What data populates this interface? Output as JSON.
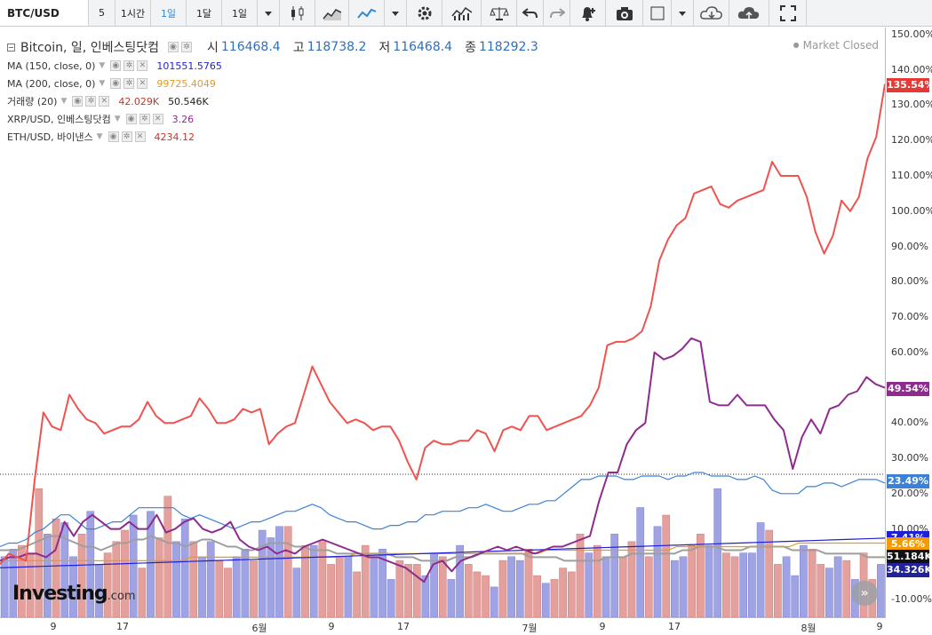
{
  "toolbar": {
    "symbol": "BTC/USD",
    "buttons": [
      {
        "label": "5",
        "icon": ""
      },
      {
        "label": "1시간",
        "icon": ""
      },
      {
        "label": "1일",
        "icon": "",
        "active": true
      },
      {
        "label": "1달",
        "icon": ""
      },
      {
        "label": "1일",
        "icon": ""
      },
      {
        "label": "",
        "icon": "dropdown-caret-icon"
      },
      {
        "label": "",
        "icon": "candlestick-icon"
      },
      {
        "label": "",
        "icon": "area-chart-icon"
      },
      {
        "label": "",
        "icon": "line-chart-icon",
        "active": true
      },
      {
        "label": "",
        "icon": "dropdown-caret-icon"
      },
      {
        "label": "",
        "icon": "gear-icon"
      },
      {
        "label": "",
        "icon": "indicators-icon"
      },
      {
        "label": "",
        "icon": "scales-icon"
      },
      {
        "label": "",
        "icon": "undo-icon"
      },
      {
        "label": "",
        "icon": "redo-icon"
      },
      {
        "label": "",
        "icon": "alert-bell-icon"
      },
      {
        "label": "",
        "icon": "camera-icon"
      },
      {
        "label": "",
        "icon": "color-square-icon"
      },
      {
        "label": "",
        "icon": "dropdown-caret-icon"
      },
      {
        "label": "",
        "icon": "cloud-download-icon"
      },
      {
        "label": "",
        "icon": "cloud-upload-icon"
      },
      {
        "label": "",
        "icon": "fullscreen-icon"
      }
    ]
  },
  "legend": {
    "main": {
      "name": "Bitcoin, 일, 인베스팅닷컴",
      "o_label": "시",
      "o": "116468.4",
      "h_label": "고",
      "h": "118738.2",
      "l_label": "저",
      "l": "116468.4",
      "c_label": "종",
      "c": "118292.3"
    },
    "studies": [
      {
        "name": "MA (150, close, 0)",
        "values": [
          "101551.5765"
        ],
        "colors": [
          "#1f1fd6"
        ]
      },
      {
        "name": "MA (200, close, 0)",
        "values": [
          "99725.4049"
        ],
        "colors": [
          "#e89a1a"
        ]
      },
      {
        "name": "거래량 (20)",
        "values": [
          "42.029K",
          "50.546K"
        ],
        "colors": [
          "#c0392b",
          "#222222"
        ]
      },
      {
        "name": "XRP/USD, 인베스팅닷컴",
        "values": [
          "3.26"
        ],
        "colors": [
          "#8e2b8e"
        ]
      },
      {
        "name": "ETH/USD, 바이낸스",
        "values": [
          "4234.12"
        ],
        "colors": [
          "#c0392b"
        ]
      }
    ]
  },
  "status": "Market Closed",
  "logo": {
    "main": "Investing",
    "suffix": ".com"
  },
  "scroll_button": "»",
  "price_axis": {
    "labels": [
      "150.00%",
      "140.00%",
      "130.00%",
      "120.00%",
      "110.00%",
      "100.00%",
      "90.00%",
      "80.00%",
      "70.00%",
      "60.00%",
      "50.00%",
      "40.00%",
      "30.00%",
      "20.00%",
      "10.00%",
      "0.00%",
      "-10.00%"
    ],
    "tags": [
      {
        "text": "135.54%",
        "value": 135.54,
        "color": "#e53935",
        "text_color": "#ffffff"
      },
      {
        "text": "49.54%",
        "value": 49.54,
        "color": "#8e2b8e",
        "text_color": "#ffffff"
      },
      {
        "text": "23.49%",
        "value": 23.49,
        "color": "#3b82d6",
        "text_color": "#ffffff"
      },
      {
        "text": "7.41%",
        "value": 7.41,
        "color": "#1f1fd6",
        "text_color": "#ffffff"
      },
      {
        "text": "5.66%",
        "value": 5.66,
        "color": "#f59b00",
        "text_color": "#ffffff"
      },
      {
        "text": "51.184K",
        "value": 2.2,
        "color": "#111111",
        "text_color": "#ffffff"
      },
      {
        "text": "34.326K",
        "value": -1.7,
        "color": "#22239a",
        "text_color": "#ffffff"
      }
    ]
  },
  "time_axis": {
    "labels": [
      "9",
      "17",
      "6월",
      "9",
      "17",
      "7월",
      "9",
      "17",
      "8월",
      "9"
    ]
  },
  "chart_data": {
    "type": "line",
    "ylabel": "",
    "ylim": [
      -15,
      152
    ],
    "xlim": [
      0,
      117
    ],
    "series": [
      {
        "color": "#ef5350",
        "values": [
          0,
          3,
          2,
          1,
          24,
          43,
          39,
          38,
          48,
          44,
          41,
          40,
          37,
          38,
          39,
          39,
          41,
          46,
          42,
          40,
          40,
          41,
          42,
          47,
          44,
          40,
          40,
          41,
          44,
          43,
          44,
          34,
          37,
          39,
          40,
          48,
          56,
          51,
          46,
          43,
          40,
          41,
          40,
          38,
          39,
          39,
          35,
          29,
          24,
          33,
          35,
          34,
          34,
          35,
          35,
          38,
          37,
          32,
          38,
          39,
          38,
          42,
          42,
          38,
          39,
          40,
          41,
          42,
          45,
          50,
          62,
          63,
          63,
          64,
          66,
          73,
          86,
          92,
          96,
          98,
          105,
          106,
          107,
          102,
          101,
          103,
          104,
          105,
          106,
          114,
          110,
          110,
          110,
          104,
          94,
          88,
          93,
          103,
          100,
          104,
          115,
          121,
          136
        ]
      },
      {
        "color": "#8e2b8e",
        "values": [
          1,
          2,
          2,
          3,
          3,
          2,
          4,
          12,
          8,
          12,
          14,
          12,
          10,
          10,
          12,
          10,
          10,
          14,
          9,
          10,
          12,
          13,
          10,
          9,
          10,
          12,
          7,
          5,
          4,
          5,
          3,
          4,
          3,
          5,
          6,
          7,
          6,
          5,
          4,
          3,
          2,
          2,
          1,
          0,
          -1,
          -3,
          -5,
          0,
          1,
          -2,
          1,
          2,
          3,
          4,
          5,
          4,
          5,
          4,
          3,
          4,
          5,
          5,
          6,
          7,
          8,
          18,
          26,
          26,
          34,
          38,
          40,
          60,
          58,
          59,
          61,
          64,
          63,
          46,
          45,
          45,
          48,
          45,
          45,
          45,
          41,
          38,
          27,
          36,
          41,
          37,
          44,
          45,
          48,
          49,
          53,
          51,
          50
        ]
      },
      {
        "color": "#3b82d6",
        "values": [
          5,
          6,
          6,
          7,
          9,
          10,
          12,
          14,
          14,
          12,
          10,
          10,
          11,
          12,
          12,
          14,
          16,
          16,
          16,
          16,
          16,
          14,
          13,
          14,
          13,
          12,
          11,
          10,
          11,
          12,
          12,
          13,
          14,
          15,
          15,
          16,
          17,
          16,
          14,
          13,
          12,
          12,
          11,
          10,
          10,
          11,
          11,
          12,
          12,
          14,
          14,
          15,
          15,
          15,
          16,
          16,
          17,
          16,
          15,
          15,
          16,
          17,
          17,
          18,
          18,
          20,
          22,
          24,
          24,
          25,
          25,
          25,
          24,
          24,
          25,
          25,
          25,
          24,
          25,
          25,
          26,
          26,
          25,
          25,
          25,
          24,
          24,
          25,
          24,
          21,
          20,
          20,
          20,
          22,
          22,
          23,
          23,
          22,
          23,
          24,
          24,
          24,
          23
        ]
      },
      {
        "color": "#1f1fd6",
        "values": [
          -1.0,
          -0.9,
          -0.8,
          -0.7,
          -0.6,
          -0.5,
          -0.4,
          -0.3,
          -0.2,
          -0.1,
          0.0,
          0.1,
          0.2,
          0.3,
          0.4,
          0.5,
          0.6,
          0.7,
          0.8,
          0.9,
          1.0,
          1.1,
          1.2,
          1.3,
          1.4,
          1.5,
          1.6,
          1.7,
          1.8,
          1.9,
          2.0,
          2.1,
          2.2,
          2.3,
          2.4,
          2.5,
          2.6,
          2.7,
          2.8,
          2.9,
          3.0,
          3.1,
          3.2,
          3.3,
          3.4,
          3.5,
          3.6,
          3.7,
          3.8,
          3.9,
          4.0,
          4.1,
          4.2,
          4.3,
          4.4,
          4.5,
          4.6,
          4.7,
          4.8,
          4.9,
          5.0,
          5.1,
          5.2,
          5.3,
          5.4,
          5.5,
          5.6,
          5.7,
          5.8,
          5.9,
          6.0,
          6.1,
          6.2,
          6.3,
          6.4,
          6.5,
          6.6,
          6.7,
          6.8,
          6.9,
          7.0,
          7.1,
          7.2,
          7.3,
          7.4
        ]
      },
      {
        "color": "#e89a1a",
        "values": [
          1,
          1,
          1,
          1,
          1,
          1,
          1,
          1,
          1,
          1,
          1,
          1,
          1,
          1,
          1,
          1,
          1,
          1,
          1,
          1,
          1,
          1,
          2,
          2,
          2,
          2,
          2,
          2,
          2,
          2,
          2,
          2,
          2,
          2,
          2,
          2,
          2,
          2,
          2,
          2,
          2,
          3,
          3,
          3,
          3,
          3,
          3,
          3,
          3,
          3,
          3,
          3,
          3,
          3,
          3,
          3,
          3,
          3,
          3,
          3,
          3,
          3,
          3,
          4,
          4,
          4,
          4,
          4,
          4,
          4,
          4,
          4,
          4,
          4,
          4,
          4,
          4,
          4,
          5,
          5,
          5,
          5,
          5,
          5,
          5,
          5,
          5,
          5,
          5,
          5,
          5,
          5,
          6,
          6,
          6,
          6,
          6,
          6,
          6,
          6,
          6,
          6,
          6
        ]
      },
      {
        "color": "#9e9e9e",
        "values": [
          4,
          4,
          4,
          5,
          6,
          7,
          8,
          8,
          7,
          6,
          5,
          5,
          4,
          5,
          6,
          6,
          7,
          7,
          8,
          7,
          6,
          6,
          5,
          6,
          7,
          7,
          6,
          5,
          5,
          4,
          4,
          5,
          6,
          6,
          6,
          5,
          5,
          4,
          4,
          4,
          3,
          3,
          3,
          3,
          3,
          3,
          3,
          2,
          2,
          2,
          1,
          1,
          1,
          1,
          2,
          2,
          2,
          3,
          3,
          3,
          3,
          3,
          3,
          2,
          2,
          2,
          2,
          1,
          1,
          1,
          1,
          1,
          2,
          2,
          2,
          3,
          3,
          3,
          3,
          3,
          3,
          4,
          4,
          5,
          5,
          5,
          4,
          4,
          4,
          5,
          5,
          5,
          5,
          5,
          4,
          4,
          4,
          4,
          3,
          3,
          3,
          3,
          3,
          2,
          2,
          2
        ]
      }
    ],
    "volume": {
      "ylim": [
        0,
        42
      ],
      "up_color": "#9fa3e3",
      "down_color": "#e3a09c",
      "values": [
        16,
        18,
        19,
        17,
        34,
        22,
        26,
        25,
        16,
        22,
        28,
        14,
        17,
        20,
        23,
        27,
        13,
        28,
        21,
        32,
        20,
        26,
        20,
        16,
        20,
        15,
        13,
        16,
        18,
        15,
        23,
        21,
        24,
        24,
        13,
        19,
        19,
        20,
        14,
        16,
        16,
        12,
        19,
        16,
        18,
        10,
        15,
        14,
        14,
        11,
        17,
        16,
        10,
        19,
        14,
        12,
        11,
        8,
        15,
        16,
        15,
        18,
        11,
        9,
        10,
        13,
        12,
        22,
        17,
        19,
        16,
        22,
        16,
        20,
        29,
        16,
        24,
        27,
        15,
        16,
        19,
        22,
        19,
        34,
        17,
        16,
        17,
        17,
        25,
        23,
        14,
        16,
        11,
        19,
        18,
        14,
        13,
        16,
        15,
        10,
        17,
        10,
        14
      ],
      "up": [
        1,
        1,
        0,
        0,
        0,
        1,
        0,
        1,
        1,
        0,
        1,
        1,
        0,
        0,
        0,
        1,
        0,
        1,
        0,
        0,
        1,
        1,
        0,
        1,
        1,
        0,
        0,
        1,
        1,
        0,
        1,
        1,
        1,
        0,
        1,
        0,
        1,
        0,
        0,
        0,
        1,
        0,
        0,
        1,
        1,
        1,
        0,
        0,
        0,
        1,
        1,
        0,
        1,
        1,
        0,
        0,
        0,
        1,
        0,
        1,
        1,
        0,
        0,
        1,
        0,
        0,
        0,
        0,
        1,
        0,
        1,
        1,
        0,
        0,
        1,
        0,
        1,
        0,
        1,
        1,
        0,
        0,
        1,
        1,
        0,
        0,
        1,
        1,
        1,
        0,
        0,
        1,
        1,
        1,
        0,
        0,
        1,
        1,
        0,
        1,
        0,
        0,
        1
      ]
    }
  }
}
